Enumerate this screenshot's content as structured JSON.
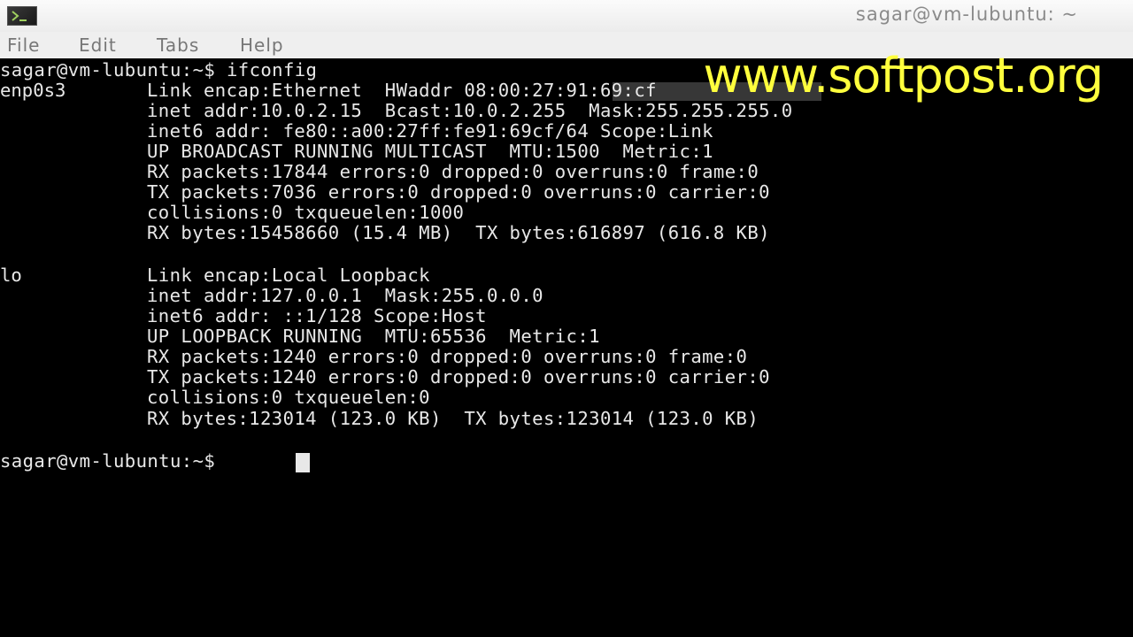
{
  "window": {
    "title": "sagar@vm-lubuntu: ~",
    "icon": "terminal-icon"
  },
  "menu": [
    "File",
    "Edit",
    "Tabs",
    "Help"
  ],
  "terminal": {
    "lines": [
      "sagar@vm-lubuntu:~$ ifconfig",
      "enp0s3",
      "Link encap:Ethernet  HWaddr 08:00:27:91:69:cf",
      "inet addr:10.0.2.15  Bcast:10.0.2.255  Mask:255.255.255.0",
      "inet6 addr: fe80::a00:27ff:fe91:69cf/64 Scope:Link",
      "UP BROADCAST RUNNING MULTICAST  MTU:1500  Metric:1",
      "RX packets:17844 errors:0 dropped:0 overruns:0 frame:0",
      "TX packets:7036 errors:0 dropped:0 overruns:0 carrier:0",
      "collisions:0 txqueuelen:1000",
      "RX bytes:15458660 (15.4 MB)  TX bytes:616897 (616.8 KB)",
      "lo",
      "Link encap:Local Loopback",
      "inet addr:127.0.0.1  Mask:255.0.0.0",
      "inet6 addr: ::1/128 Scope:Host",
      "UP LOOPBACK RUNNING  MTU:65536  Metric:1",
      "RX packets:1240 errors:0 dropped:0 overruns:0 frame:0",
      "TX packets:1240 errors:0 dropped:0 overruns:0 carrier:0",
      "collisions:0 txqueuelen:0",
      "RX bytes:123014 (123.0 KB)  TX bytes:123014 (123.0 KB)",
      "sagar@vm-lubuntu:~$"
    ]
  },
  "overlay": {
    "watermark": "www.softpost.org",
    "watermark_color": "#ffff3d"
  }
}
